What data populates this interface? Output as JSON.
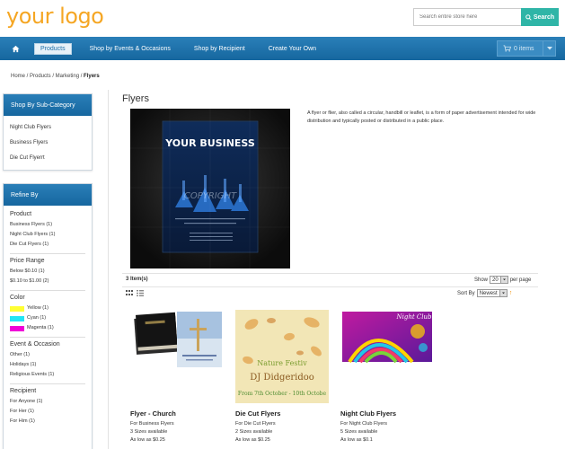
{
  "header": {
    "logo": "your logo",
    "search_placeholder": "Search entire store here",
    "search_button": "Search"
  },
  "nav": {
    "items": [
      "Products",
      "Shop by Events & Occasions",
      "Shop by Recipient",
      "Create Your Own"
    ],
    "cart": "0 items"
  },
  "breadcrumb": {
    "path": "Home / Products / Marketing / ",
    "current": "Flyers"
  },
  "subcategory": {
    "title": "Shop By Sub-Category",
    "items": [
      "Night Club Flyers",
      "Business Flyers",
      "Die Cut Flyerrt"
    ]
  },
  "refine": {
    "title": "Refine By",
    "product": {
      "title": "Product",
      "items": [
        "Business Flyers (1)",
        "Night Club Flyers (1)",
        "Die Cut Flyers (1)"
      ]
    },
    "price": {
      "title": "Price Range",
      "items": [
        "Below $0.10 (1)",
        "$0.10 to $1.00 (2)"
      ]
    },
    "color": {
      "title": "Color",
      "items": [
        {
          "label": "Yellow (1)",
          "color": "#ffff33"
        },
        {
          "label": "Cyan (1)",
          "color": "#22e6f5"
        },
        {
          "label": "Magenta (1)",
          "color": "#f000d8"
        }
      ]
    },
    "event": {
      "title": "Event & Occasion",
      "items": [
        "Other (1)",
        "Holidays (1)",
        "Religious Events (1)"
      ]
    },
    "recipient": {
      "title": "Recipient",
      "items": [
        "For Anyone (1)",
        "For Her (1)",
        "For Him (1)"
      ]
    }
  },
  "main": {
    "title": "Flyers",
    "hero_heading": "YOUR BUSINESS",
    "watermark": "COPYRIGHT",
    "description": "A flyer or flier, also called a circular, handbill or leaflet, is a form of paper advertisement intended for wide distribution and typically posted or distributed in a public place.",
    "count": "3 Item(s)",
    "show_label": "Show",
    "show_value": "20",
    "per_page": "per page",
    "sort_label": "Sort By",
    "sort_value": "Newest"
  },
  "products": [
    {
      "name": "Flyer - Church",
      "line1": "For Business Flyers",
      "line2": "3 Sizes available",
      "price": "As low as $0.25"
    },
    {
      "name": "Die Cut Flyers",
      "line1": "For Die Cut Flyers",
      "line2": "2 Sizes available",
      "price": "As low as $0.25",
      "thumb_title": "Nature Festiv",
      "thumb_name": "DJ Didgeridoo",
      "thumb_date": "From 7th October - 10th Octobe"
    },
    {
      "name": "Night Club Flyers",
      "line1": "For Night Club Flyers",
      "line2": "5 Sizes available",
      "price": "As low as $0.1",
      "thumb_title": "Night Club"
    }
  ],
  "colors": {
    "accent": "#2a7fb8",
    "logo": "#f5a623",
    "search": "#2fb5a7"
  }
}
